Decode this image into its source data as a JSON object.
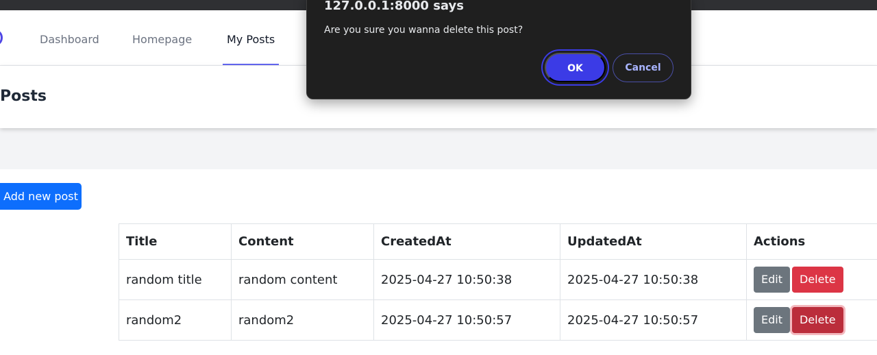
{
  "nav": {
    "items": [
      {
        "label": "Dashboard"
      },
      {
        "label": "Homepage"
      },
      {
        "label": "My Posts"
      }
    ]
  },
  "header": {
    "title": "Posts"
  },
  "actions": {
    "add_label": "Add new post"
  },
  "table": {
    "headers": [
      "Title",
      "Content",
      "CreatedAt",
      "UpdatedAt",
      "Actions"
    ],
    "rows": [
      {
        "title": "random title",
        "content": "random content",
        "created": "2025-04-27 10:50:38",
        "updated": "2025-04-27 10:50:38",
        "edit": "Edit",
        "delete": "Delete"
      },
      {
        "title": "random2",
        "content": "random2",
        "created": "2025-04-27 10:50:57",
        "updated": "2025-04-27 10:50:57",
        "edit": "Edit",
        "delete": "Delete"
      }
    ]
  },
  "dialog": {
    "title": "127.0.0.1:8000 says",
    "message": "Are you sure you wanna delete this post?",
    "ok_label": "OK",
    "cancel_label": "Cancel"
  }
}
